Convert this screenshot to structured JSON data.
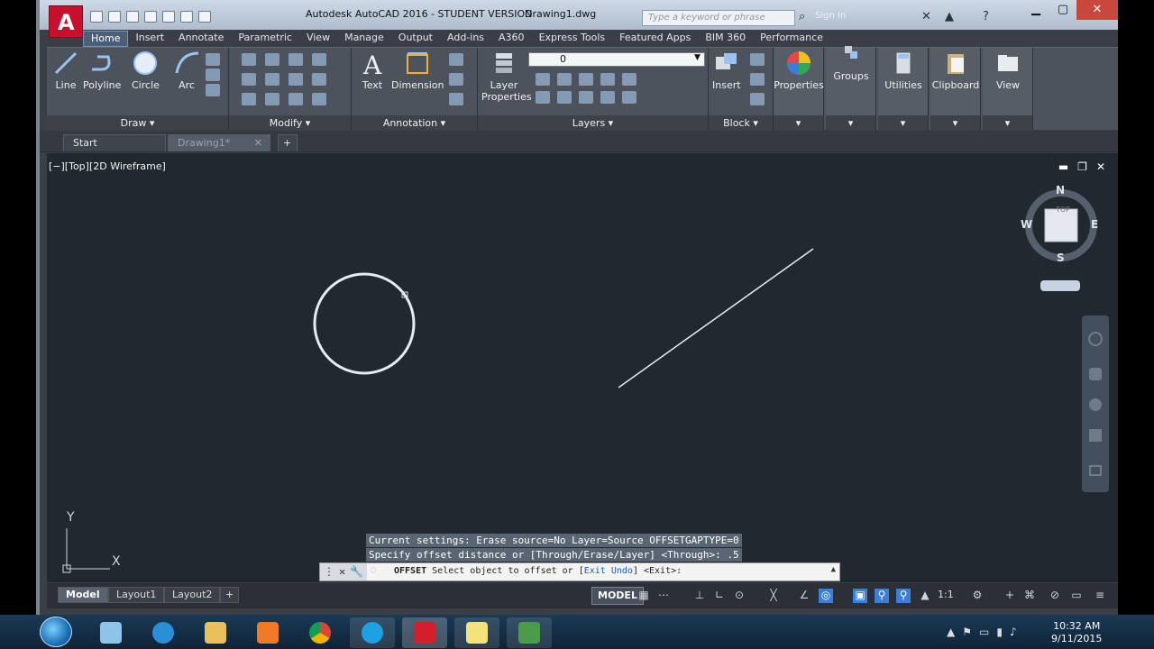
{
  "title_bar": {
    "app_title": "Autodesk AutoCAD 2016 - STUDENT VERSION",
    "file_name": "Drawing1.dwg",
    "search_placeholder": "Type a keyword or phrase",
    "sign_in": "Sign In"
  },
  "ribbon_tabs": [
    "Home",
    "Insert",
    "Annotate",
    "Parametric",
    "View",
    "Manage",
    "Output",
    "Add-ins",
    "A360",
    "Express Tools",
    "Featured Apps",
    "BIM 360",
    "Performance"
  ],
  "active_tab": "Home",
  "draw_panel": {
    "title": "Draw",
    "tools": [
      "Line",
      "Polyline",
      "Circle",
      "Arc"
    ]
  },
  "modify_panel": {
    "title": "Modify"
  },
  "annotation_panel": {
    "title": "Annotation",
    "tools": [
      "Text",
      "Dimension"
    ]
  },
  "layers_panel": {
    "title": "Layers",
    "tool": "Layer Properties",
    "current_layer": "0"
  },
  "block_panel": {
    "title": "Block",
    "tool": "Insert"
  },
  "extra_panels": [
    "Properties",
    "Groups",
    "Utilities",
    "Clipboard",
    "View"
  ],
  "document_tabs": {
    "start": "Start",
    "drawing": "Drawing1*"
  },
  "viewport": {
    "label": "[−][Top][2D Wireframe]",
    "viewcube": {
      "top_face": "TOP",
      "north": "N",
      "south": "S",
      "east": "E",
      "west": "W"
    },
    "ucs": {
      "x": "X",
      "y": "Y"
    }
  },
  "command": {
    "history": [
      "Current settings: Erase source=No  Layer=Source  OFFSETGAPTYPE=0",
      "Specify offset distance or [Through/Erase/Layer] <Through>: .5"
    ],
    "name": "OFFSET",
    "prompt": "Select object to offset or [",
    "opt1": "Exit",
    "opt2": "Undo",
    "suffix": "] <Exit>:"
  },
  "layout_tabs": [
    "Model",
    "Layout1",
    "Layout2"
  ],
  "status": {
    "model": "MODEL",
    "scale": "1:1"
  },
  "clock": {
    "time": "10:32 AM",
    "date": "9/11/2015"
  }
}
